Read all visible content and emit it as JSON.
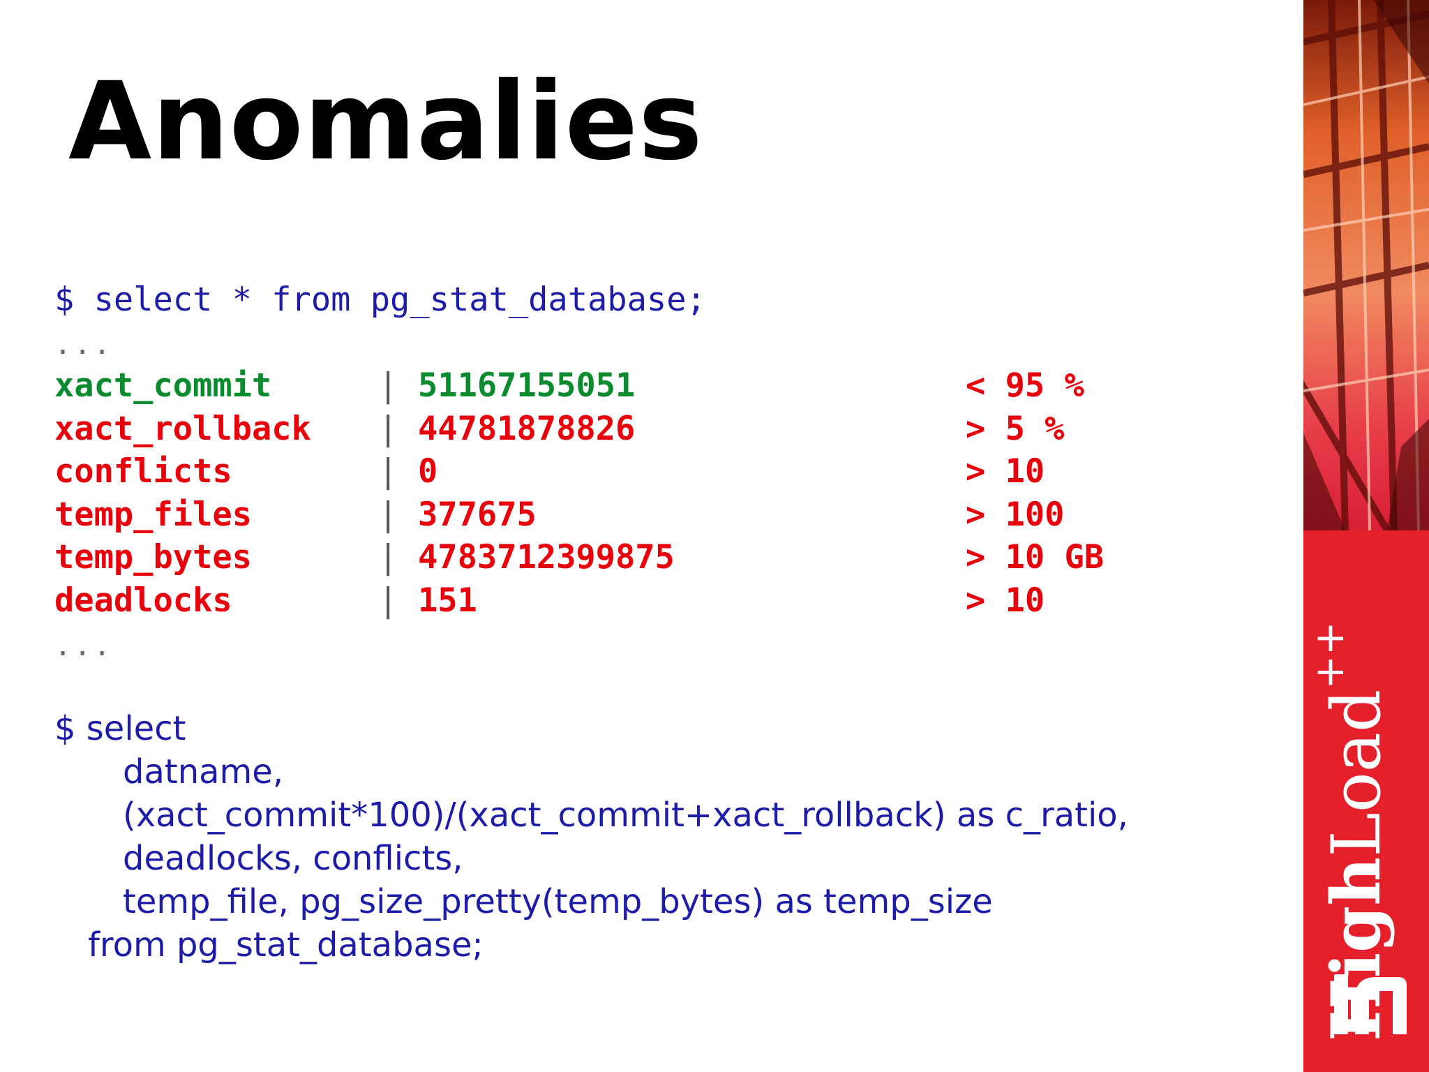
{
  "slide": {
    "title": "Anomalies"
  },
  "query1": {
    "command": "$ select * from pg_stat_database;",
    "ellipsis_top": "...",
    "ellipsis_bottom": "...",
    "rows": [
      {
        "name": "xact_commit",
        "sep": "|",
        "value": "51167155051",
        "threshold": "< 95 %"
      },
      {
        "name": "xact_rollback",
        "sep": "|",
        "value": "44781878826",
        "threshold": "> 5 %"
      },
      {
        "name": "conflicts",
        "sep": "|",
        "value": "0",
        "threshold": "> 10"
      },
      {
        "name": "temp_files",
        "sep": "|",
        "value": "377675",
        "threshold": "> 100"
      },
      {
        "name": "temp_bytes",
        "sep": "|",
        "value": "4783712399875",
        "threshold": "> 10 GB"
      },
      {
        "name": "deadlocks",
        "sep": "|",
        "value": "151",
        "threshold": "> 10"
      }
    ]
  },
  "query2": {
    "lines": [
      "$ select",
      "datname,",
      "(xact_commit*100)/(xact_commit+xact_rollback) as c_ratio,",
      "deadlocks, conflicts,",
      "temp_file, pg_size_pretty(temp_bytes) as temp_size",
      "from pg_stat_database;"
    ]
  },
  "brand": {
    "name_bold": "High",
    "name_light": "Load",
    "superscript": "++"
  },
  "colors": {
    "accent_red": "#e6202a",
    "code_blue": "#1c1ca8",
    "green": "#0a8c2e",
    "red": "#e8000b"
  }
}
